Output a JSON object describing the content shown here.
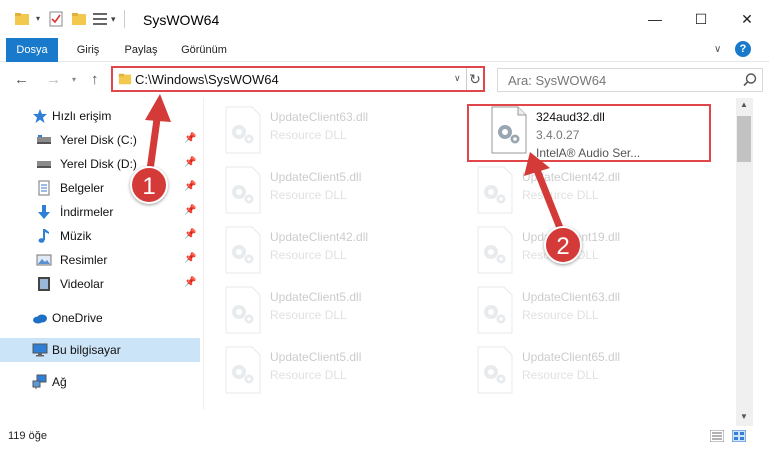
{
  "window": {
    "title": "SysWOW64"
  },
  "ribbon": {
    "tabs": [
      "Dosya",
      "Giriş",
      "Paylaş",
      "Görünüm"
    ],
    "help": "?"
  },
  "navigation": {
    "address": "C:\\Windows\\SysWOW64",
    "search_placeholder": "Ara: SysWOW64"
  },
  "sidebar": {
    "items": [
      {
        "label": "Hızlı erişim",
        "icon": "star-icon",
        "pinned": false
      },
      {
        "label": "Yerel Disk (C:)",
        "icon": "drive-icon",
        "pinned": true
      },
      {
        "label": "Yerel Disk (D:)",
        "icon": "drive-icon",
        "pinned": true
      },
      {
        "label": "Belgeler",
        "icon": "documents-icon",
        "pinned": true
      },
      {
        "label": "İndirmeler",
        "icon": "downloads-icon",
        "pinned": true
      },
      {
        "label": "Müzik",
        "icon": "music-icon",
        "pinned": true
      },
      {
        "label": "Resimler",
        "icon": "pictures-icon",
        "pinned": true
      },
      {
        "label": "Videolar",
        "icon": "videos-icon",
        "pinned": true
      },
      {
        "label": "OneDrive",
        "icon": "cloud-icon",
        "pinned": false
      },
      {
        "label": "Bu bilgisayar",
        "icon": "computer-icon",
        "pinned": false,
        "selected": true
      },
      {
        "label": "Ağ",
        "icon": "network-icon",
        "pinned": false
      }
    ]
  },
  "files": [
    {
      "name": "UpdateClient63.dll",
      "type": "Resource DLL",
      "faded": true
    },
    {
      "name": "324aud32.dll",
      "type": "3.4.0.27",
      "desc": "IntelA® Audio Ser...",
      "faded": false,
      "highlighted": true
    },
    {
      "name": "UpdateClient5.dll",
      "type": "Resource DLL",
      "faded": true
    },
    {
      "name": "UpdateClient42.dll",
      "type": "Resource DLL",
      "faded": true
    },
    {
      "name": "UpdateClient42.dll",
      "type": "Resource DLL",
      "faded": true
    },
    {
      "name": "UpdateClient19.dll",
      "type": "Resource DLL",
      "faded": true
    },
    {
      "name": "UpdateClient5.dll",
      "type": "Resource DLL",
      "faded": true
    },
    {
      "name": "UpdateClient63.dll",
      "type": "Resource DLL",
      "faded": true
    },
    {
      "name": "UpdateClient5.dll",
      "type": "Resource DLL",
      "faded": true
    },
    {
      "name": "UpdateClient65.dll",
      "type": "Resource DLL",
      "faded": true
    }
  ],
  "status": {
    "count": "119 öğe"
  },
  "callouts": [
    "1",
    "2"
  ],
  "colors": {
    "accent": "#1979ca",
    "highlight": "#e0464a",
    "callout": "#d33a38",
    "selected": "#cce4f7"
  }
}
